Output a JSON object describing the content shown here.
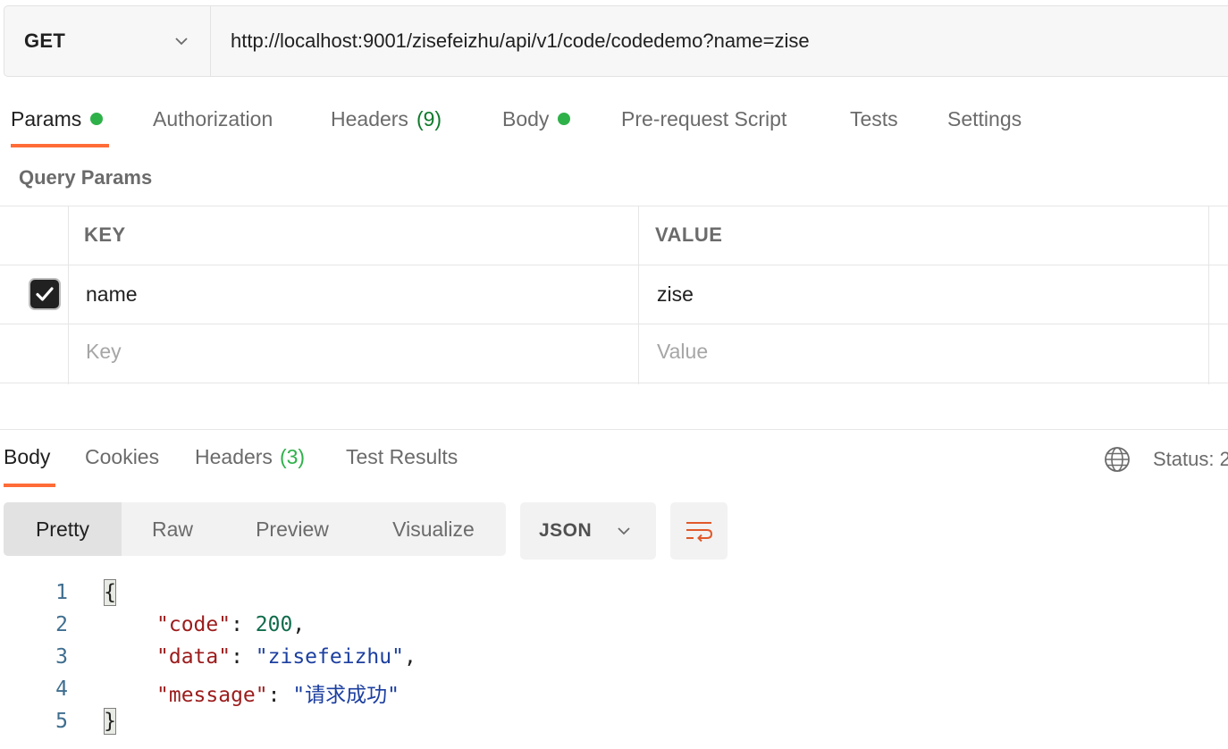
{
  "request": {
    "method": "GET",
    "url": "http://localhost:9001/zisefeizhu/api/v1/code/codedemo?name=zise"
  },
  "request_tabs": [
    {
      "label": "Params",
      "dot": true,
      "count": ""
    },
    {
      "label": "Authorization",
      "dot": false,
      "count": ""
    },
    {
      "label": "Headers",
      "dot": false,
      "count": "(9)"
    },
    {
      "label": "Body",
      "dot": true,
      "count": ""
    },
    {
      "label": "Pre-request Script",
      "dot": false,
      "count": ""
    },
    {
      "label": "Tests",
      "dot": false,
      "count": ""
    },
    {
      "label": "Settings",
      "dot": false,
      "count": ""
    }
  ],
  "query_params": {
    "title": "Query Params",
    "headers": {
      "key": "KEY",
      "value": "VALUE"
    },
    "rows": [
      {
        "key": "name",
        "value": "zise",
        "checked": true
      }
    ],
    "placeholders": {
      "key": "Key",
      "value": "Value"
    }
  },
  "response": {
    "tabs": [
      {
        "label": "Body",
        "count": ""
      },
      {
        "label": "Cookies",
        "count": ""
      },
      {
        "label": "Headers",
        "count": "(3)"
      },
      {
        "label": "Test Results",
        "count": ""
      }
    ],
    "status_label": "Status: 2",
    "views": [
      "Pretty",
      "Raw",
      "Preview",
      "Visualize"
    ],
    "format": "JSON",
    "lines": [
      {
        "num": "1"
      },
      {
        "num": "2",
        "key": "\"code\"",
        "sep": ": ",
        "val": "200",
        "tail": ","
      },
      {
        "num": "3",
        "key": "\"data\"",
        "sep": ": ",
        "val": "\"zisefeizhu\"",
        "tail": ","
      },
      {
        "num": "4",
        "key": "\"message\"",
        "sep": ": ",
        "val": "\"请求成功\"",
        "tail": ""
      },
      {
        "num": "5"
      }
    ],
    "open_brace": "{",
    "close_brace": "}"
  },
  "colors": {
    "accent": "#ff6c37",
    "dot_green": "#2fb14a",
    "json_key": "#9c1c1c",
    "json_string": "#1c3fa0",
    "json_number": "#106c4b"
  }
}
